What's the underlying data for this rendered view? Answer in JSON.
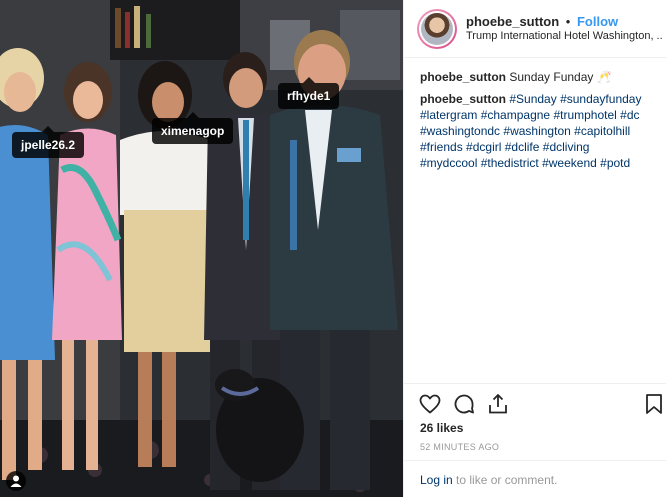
{
  "post": {
    "username": "phoebe_sutton",
    "dot": "•",
    "follow_label": "Follow",
    "location": "Trump International Hotel Washington, ...",
    "caption_line1": "Sunday Funday 🥂",
    "hashtags": [
      "#Sunday",
      "#sundayfunday",
      "#latergram",
      "#champagne",
      "#trumphotel",
      "#dc",
      "#washingtondc",
      "#washington",
      "#capitolhill",
      "#friends",
      "#dcgirl",
      "#dclife",
      "#dcliving",
      "#mydccool",
      "#thedistrict",
      "#weekend",
      "#potd"
    ],
    "likes": "26 likes",
    "time_ago": "52 MINUTES AGO",
    "login_link": "Log in",
    "login_rest": " to like or comment."
  },
  "tags": {
    "jpelle": "jpelle26.2",
    "ximena": "ximenagop",
    "rfhyde": "rfhyde1"
  },
  "icons": {
    "like": "heart-icon",
    "comment": "comment-icon",
    "share": "share-icon",
    "save": "bookmark-icon",
    "tagged_users": "user-icon"
  },
  "colors": {
    "link_blue": "#3897f0",
    "hashtag_blue": "#003569",
    "muted": "#999999"
  }
}
